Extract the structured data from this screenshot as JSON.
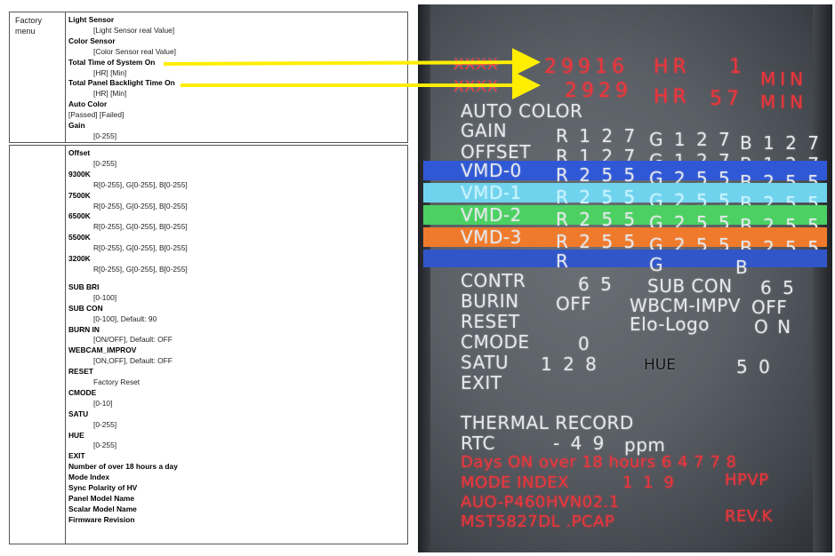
{
  "doc": {
    "section_label": "Factory menu",
    "box1": [
      {
        "text": "Light Sensor",
        "kind": "h"
      },
      {
        "text": "[Light Sensor real Value]",
        "kind": "v"
      },
      {
        "text": "Color Sensor",
        "kind": "h"
      },
      {
        "text": "[Color Sensor real Value]",
        "kind": "v"
      },
      {
        "text": "Total Time of System On",
        "kind": "h"
      },
      {
        "text": "[HR] [Min]",
        "kind": "v"
      },
      {
        "text": "Total Panel Backlight Time On",
        "kind": "h"
      },
      {
        "text": "[HR] [Min]",
        "kind": "v"
      },
      {
        "text": "Auto Color",
        "kind": "h"
      },
      {
        "text": "[Passed] [Failed]",
        "kind": "v0"
      },
      {
        "text": "Gain",
        "kind": "h"
      },
      {
        "text": "[0-255]",
        "kind": "v"
      }
    ],
    "box2": [
      {
        "text": "Offset",
        "kind": "h"
      },
      {
        "text": "[0-255]",
        "kind": "v"
      },
      {
        "text": "9300K",
        "kind": "h"
      },
      {
        "text": "R[0-255], G[0-255], B[0-255]",
        "kind": "v"
      },
      {
        "text": "7500K",
        "kind": "h"
      },
      {
        "text": "R[0-255], G[0-255], B[0-255]",
        "kind": "v"
      },
      {
        "text": "6500K",
        "kind": "h"
      },
      {
        "text": "R[0-255], G[0-255], B[0-255]",
        "kind": "v"
      },
      {
        "text": "5500K",
        "kind": "h"
      },
      {
        "text": "R[0-255], G[0-255], B[0-255]",
        "kind": "v"
      },
      {
        "text": "3200K",
        "kind": "h"
      },
      {
        "text": "R[0-255], G[0-255], B[0-255]",
        "kind": "v"
      },
      {
        "text": "",
        "kind": "gap"
      },
      {
        "text": "SUB BRI",
        "kind": "h"
      },
      {
        "text": "[0-100]",
        "kind": "v"
      },
      {
        "text": "SUB CON",
        "kind": "h"
      },
      {
        "text": "[0-100], Default:  90",
        "kind": "v"
      },
      {
        "text": "BURN IN",
        "kind": "h"
      },
      {
        "text": "[ON/OFF], Default: OFF",
        "kind": "v"
      },
      {
        "text": "WEBCAM_IMPROV",
        "kind": "h"
      },
      {
        "text": "[ON,OFF], Default: OFF",
        "kind": "v"
      },
      {
        "text": "RESET",
        "kind": "h"
      },
      {
        "text": "Factory Reset",
        "kind": "v"
      },
      {
        "text": "CMODE",
        "kind": "h"
      },
      {
        "text": "[0-10]",
        "kind": "v"
      },
      {
        "text": "SATU",
        "kind": "h"
      },
      {
        "text": "[0-255]",
        "kind": "v"
      },
      {
        "text": "HUE",
        "kind": "h"
      },
      {
        "text": "[0-255]",
        "kind": "v"
      },
      {
        "text": "EXIT",
        "kind": "h"
      },
      {
        "text": "Number of over 18 hours a day",
        "kind": "h"
      },
      {
        "text": "Mode Index",
        "kind": "h"
      },
      {
        "text": "Sync Polarity of HV",
        "kind": "h"
      },
      {
        "text": "Panel Model Name",
        "kind": "h"
      },
      {
        "text": "Scalar Model Name",
        "kind": "h"
      },
      {
        "text": "Firmware Revision",
        "kind": "h"
      }
    ]
  },
  "osd": {
    "xx1": "XXXX",
    "sys_hr": "29916",
    "hr_label": "HR",
    "sys_min": "1",
    "min_label": "MIN",
    "xx2": "XXXX",
    "bl_hr": "2929",
    "bl_min": "57",
    "auto_color": "AUTO COLOR",
    "gain": {
      "label": "GAIN",
      "r": "R 1 2 7",
      "g": "G 1 2 7",
      "b": "B 1 2 7"
    },
    "offset": {
      "label": "OFFSET",
      "r": "R 1 2 7",
      "g": "G 1 2 7",
      "b": "B 1 2 7"
    },
    "vmd": [
      {
        "label": "VMD-0",
        "r": "R 2 5 5",
        "g": "G 2 5 5",
        "b": "B 2 5 5"
      },
      {
        "label": "VMD-1",
        "r": "R 2 5 5",
        "g": "G 2 5 5",
        "b": "B 2 5 5"
      },
      {
        "label": "VMD-2",
        "r": "R 2 5 5",
        "g": "G 2 5 5",
        "b": "B 2 5 5"
      },
      {
        "label": "VMD-3",
        "r": "R 2 5 5",
        "g": "G 2 5 5",
        "b": "B 2 5 5"
      }
    ],
    "rgb_r": "R",
    "rgb_g": "G",
    "rgb_b": "B",
    "contr": "CONTR",
    "contr_val": "6 5",
    "subcon": "SUB CON",
    "subcon_val": "6 5",
    "burnin": "BURIN",
    "burnin_val": "OFF",
    "wbcm": "WBCM-IMPV",
    "wbcm_val": "OFF",
    "reset": "RESET",
    "elo": "Elo-Logo",
    "elo_val": "O N",
    "cmode": "CMODE",
    "cmode_val": "0",
    "satu": "SATU",
    "satu_val": "1 2 8",
    "hue": "HUE",
    "hue_val": "5 0",
    "exit": "EXIT",
    "thermal": "THERMAL RECORD",
    "rtc": "RTC",
    "rtc_val": "- 4 9",
    "rtc_unit": "ppm",
    "days_on": "Days ON over 18 hours  6 4 7 7 8",
    "mode_index": "MODE INDEX",
    "mode_index_val": "1 1 9",
    "mode_index_code": "HPVP",
    "panel": "AUO-P460HVN02.1",
    "scalar": "MST5827DL .PCAP",
    "rev": "REV.K"
  },
  "colors": {
    "arrow": "#ffee00",
    "osd_red": "#f0343a",
    "band_blue": "#2f58d6",
    "band_cyan": "#6fd3ee",
    "band_green": "#4bd061",
    "band_orange": "#ef7a2c"
  }
}
